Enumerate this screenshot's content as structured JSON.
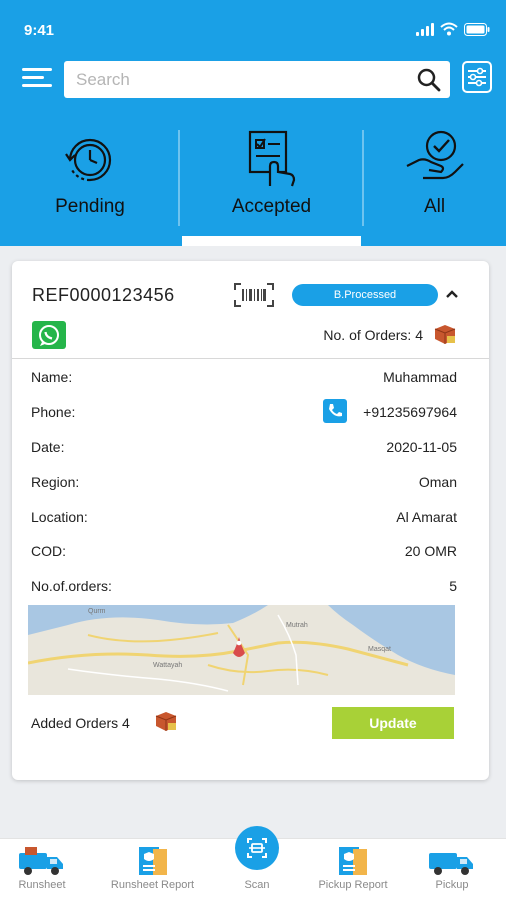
{
  "status": {
    "time": "9:41"
  },
  "search": {
    "placeholder": "Search"
  },
  "tabs": [
    {
      "label": "Pending",
      "icon": "clock-icon"
    },
    {
      "label": "Accepted",
      "icon": "clipboard-hand-icon"
    },
    {
      "label": "All",
      "icon": "hand-check-icon"
    }
  ],
  "order": {
    "ref": "REF0000123456",
    "status_badge": "B.Processed",
    "no_of_orders_label": "No. of Orders: 4",
    "fields": [
      {
        "key": "Name:",
        "value": "Muhammad"
      },
      {
        "key": "Phone:",
        "value": "+91235697964"
      },
      {
        "key": "Date:",
        "value": "2020-11-05"
      },
      {
        "key": "Region:",
        "value": "Oman"
      },
      {
        "key": "Location:",
        "value": "Al Amarat"
      },
      {
        "key": "COD:",
        "value": "20 OMR"
      },
      {
        "key": "No.of.orders:",
        "value": "5"
      }
    ],
    "map_labels": [
      "Qurm",
      "Mutrah",
      "Masqat",
      "Wattayah"
    ],
    "added_orders": "Added Orders 4",
    "update_label": "Update"
  },
  "bottom_nav": [
    {
      "label": "Runsheet",
      "icon": "truck-icon"
    },
    {
      "label": "Runsheet Report",
      "icon": "report-icon"
    },
    {
      "label": "Scan",
      "icon": "scan-icon"
    },
    {
      "label": "Pickup Report",
      "icon": "report-icon"
    },
    {
      "label": "Pickup",
      "icon": "truck-icon"
    }
  ],
  "colors": {
    "primary": "#1aa0e6",
    "accent": "#a8d137",
    "whatsapp": "#25b54a"
  }
}
